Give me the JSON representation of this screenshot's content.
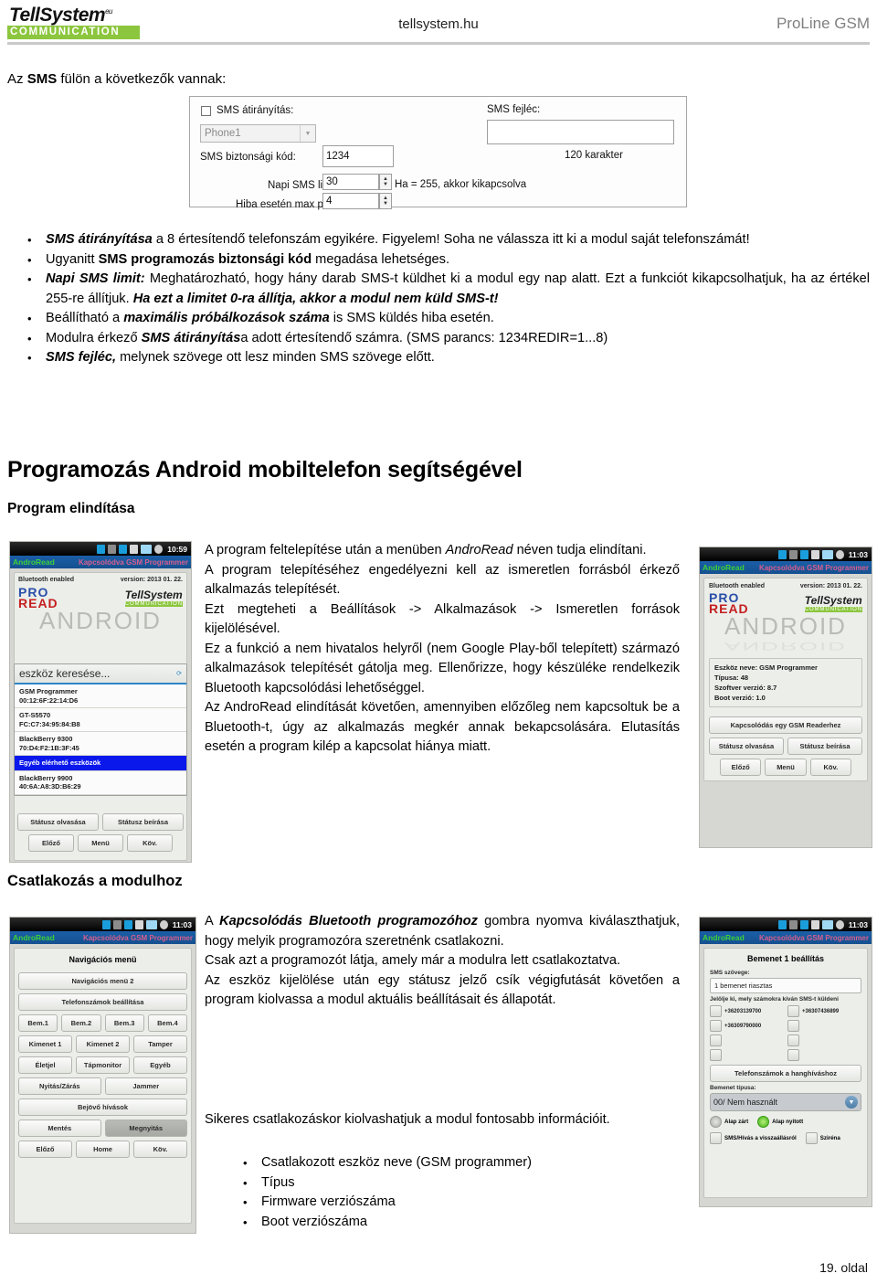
{
  "header": {
    "logo_word": "TellSystem",
    "logo_super": "eu",
    "logo_band": "COMMUNICATION",
    "site": "tellsystem.hu",
    "product": "ProLine GSM"
  },
  "intro": {
    "prefix": "Az ",
    "bold": "SMS",
    "suffix": " fülön a következők vannak:"
  },
  "sms_panel": {
    "redirect_checkbox_label": "SMS átirányítás:",
    "phone_select_value": "Phone1",
    "security_code_label": "SMS biztonsági kód:",
    "security_code_value": "1234",
    "daily_limit_label": "Napi SMS limit:",
    "daily_limit_value": "30",
    "daily_limit_hint": "Ha = 255, akkor kikapcsolva",
    "max_retry_label": "Hiba esetén max próba:",
    "max_retry_value": "4",
    "header_label": "SMS fejléc:",
    "header_value": "",
    "char_count": "120 karakter"
  },
  "sms_bullets": [
    {
      "parts": [
        {
          "t": "SMS átirányítása",
          "s": "bi"
        },
        {
          "t": " a 8 értesítendő telefonszám egyikére. Figyelem! Soha ne válassza itt ki a modul saját telefonszámát!",
          "s": ""
        }
      ]
    },
    {
      "parts": [
        {
          "t": "Ugyanitt ",
          "s": ""
        },
        {
          "t": "SMS programozás biztonsági kód",
          "s": "bb"
        },
        {
          "t": " megadása lehetséges.",
          "s": ""
        }
      ]
    },
    {
      "parts": [
        {
          "t": "Napi SMS limit:",
          "s": "bi"
        },
        {
          "t": " Meghatározható, hogy hány darab SMS-t küldhet ki a modul egy nap alatt. Ezt a funkciót kikapcsolhatjuk, ha az értékel 255-re állítjuk. ",
          "s": ""
        },
        {
          "t": "Ha ezt a limitet 0-ra állítja, akkor a modul nem küld SMS-t!",
          "s": "bi"
        }
      ]
    },
    {
      "parts": [
        {
          "t": "Beállítható a ",
          "s": ""
        },
        {
          "t": "maximális próbálkozások száma",
          "s": "bi"
        },
        {
          "t": " is SMS küldés hiba esetén.",
          "s": ""
        }
      ]
    },
    {
      "parts": [
        {
          "t": "Modulra érkező ",
          "s": ""
        },
        {
          "t": "SMS átirányítás",
          "s": "bi"
        },
        {
          "t": "a adott értesítendő számra. (SMS parancs: 1234REDIR=1...8)",
          "s": ""
        }
      ]
    },
    {
      "parts": [
        {
          "t": "SMS fejléc,",
          "s": "bi"
        },
        {
          "t": " melynek szövege ott lesz minden SMS szövege előtt.",
          "s": ""
        }
      ]
    }
  ],
  "section_title": "Programozás Android mobiltelefon segítségével",
  "subsection_start": "Program elindítása",
  "subsection_connect": "Csatlakozás a modulhoz",
  "top_text": [
    {
      "parts": [
        {
          "t": "A program feltelepítése után a menüben ",
          "s": ""
        },
        {
          "t": "AndroRead",
          "s": "i"
        },
        {
          "t": " néven tudja elindítani.",
          "s": ""
        }
      ]
    },
    {
      "parts": [
        {
          "t": "A program telepítéséhez engedélyezni kell az ismeretlen forrásból érkező alkalmazás telepítését.",
          "s": ""
        }
      ]
    },
    {
      "parts": [
        {
          "t": "Ezt megteheti a Beállítások -> Alkalmazások -> Ismeretlen források kijelölésével.",
          "s": ""
        }
      ]
    },
    {
      "parts": [
        {
          "t": "Ez a funkció a nem hivatalos helyről (nem Google Play-ből telepített) származó alkalmazások telepítését gátolja meg. Ellenőrizze, hogy készüléke rendelkezik Bluetooth kapcsolódási lehetőséggel.",
          "s": ""
        }
      ]
    },
    {
      "parts": [
        {
          "t": "Az AndroRead elindítását követően, amennyiben előzőleg nem kapcsoltuk be a Bluetooth-t, úgy az alkalmazás megkér annak bekapcsolására. Elutasítás esetén a program kilép a kapcsolat hiánya miatt.",
          "s": ""
        }
      ]
    }
  ],
  "bottom_text": [
    {
      "parts": [
        {
          "t": "A ",
          "s": ""
        },
        {
          "t": "Kapcsolódás Bluetooth programozóhoz",
          "s": "bi"
        },
        {
          "t": " gombra nyomva kiválaszthatjuk, hogy melyik programozóra szeretnénk csatlakozni.",
          "s": ""
        }
      ]
    },
    {
      "parts": [
        {
          "t": "Csak azt a programozót látja, amely már a modulra lett csatlakoztatva.",
          "s": ""
        }
      ]
    },
    {
      "parts": [
        {
          "t": "Az eszköz kijelölése után egy státusz jelző csík végigfutását követően a program kiolvassa a modul aktuális beállításait és állapotát.",
          "s": ""
        }
      ]
    }
  ],
  "bottom_text2": "Sikeres csatlakozáskor kiolvashatjuk a modul fontosabb információit.",
  "bottom_bullets": [
    "Csatlakozott eszköz neve (GSM programmer)",
    "Típus",
    "Firmware verziószáma",
    "Boot verziószáma"
  ],
  "phone_device_list": {
    "time": "10:59",
    "app_name": "AndroRead",
    "title_right": "Kapcsolódva GSM Programmer",
    "bt_status": "Bluetooth enabled",
    "version": "version: 2013 01. 22.",
    "logo_pro": "PRO",
    "logo_read": "READ",
    "ts_word": "TellSystem",
    "ts_band": "COMMUNICATION",
    "android_word": "ANDROID",
    "dialog_title": "eszköz keresése...",
    "devices": [
      {
        "name": "GSM Programmer",
        "mac": "00:12:6F:22:14:D6",
        "selected": false
      },
      {
        "name": "GT-S5570",
        "mac": "FC:C7:34:95:84:B8",
        "selected": false
      },
      {
        "name": "BlackBerry 9300",
        "mac": "70:D4:F2:1B:3F:45",
        "selected": false
      },
      {
        "name": "Egyéb elérhető eszközök",
        "mac": "",
        "selected": true
      },
      {
        "name": "BlackBerry 9900",
        "mac": "40:6A:A8:3D:B6:29",
        "selected": false
      }
    ],
    "btn_status_read": "Státusz olvasása",
    "btn_status_write": "Státusz beírása",
    "btn_prev": "Előző",
    "btn_menu": "Menü",
    "btn_next": "Köv."
  },
  "phone_connected": {
    "time": "11:03",
    "app_name": "AndroRead",
    "title_right": "Kapcsolódva GSM Programmer",
    "bt_status": "Bluetooth enabled",
    "version": "version: 2013 01. 22.",
    "logo_pro": "PRO",
    "logo_read": "READ",
    "ts_word": "TellSystem",
    "ts_band": "COMMUNICATION",
    "android_word": "ANDROID",
    "info_lines": [
      "Eszköz neve: GSM Programmer",
      "Típusa: 48",
      "Szoftver verzió: 8.7",
      "Boot verzió: 1.0"
    ],
    "btn_connect": "Kapcsolódás egy GSM Readerhez",
    "btn_status_read": "Státusz olvasása",
    "btn_status_write": "Státusz beírása",
    "btn_prev": "Előző",
    "btn_menu": "Menü",
    "btn_next": "Köv."
  },
  "phone_nav_menu": {
    "time": "11:03",
    "app_name": "AndroRead",
    "title_right": "Kapcsolódva GSM Programmer",
    "title": "Navigációs menü",
    "rows": [
      [
        "Navigációs menü 2"
      ],
      [
        "Telefonszámok beállítása"
      ],
      [
        "Bem.1",
        "Bem.2",
        "Bem.3",
        "Bem.4"
      ],
      [
        "Kimenet 1",
        "Kimenet 2",
        "Tamper"
      ],
      [
        "Életjel",
        "Tápmonitor",
        "Egyéb"
      ],
      [
        "Nyitás/Zárás",
        "Jammer"
      ],
      [
        "Bejövő hívások"
      ],
      [
        "Mentés",
        "Megnyitás"
      ],
      [
        "Előző",
        "Home",
        "Köv."
      ]
    ],
    "highlight": "Megnyitás"
  },
  "phone_input_settings": {
    "time": "11:03",
    "app_name": "AndroRead",
    "title_right": "Kapcsolódva GSM Programmer",
    "title": "Bemenet 1 beállítás",
    "sms_text_label": "SMS szövege:",
    "sms_text_value": "1 bemenet riasztas",
    "select_numbers_label": "Jelölje ki, mely számokra kíván SMS-t küldeni",
    "numbers": [
      "+36203139700",
      "+36307436899",
      "+36309790000",
      "",
      "",
      "",
      "",
      ""
    ],
    "btn_voice_numbers": "Telefonszámok a hanghíváshoz",
    "input_type_label": "Bemenet típusa:",
    "input_type_value": "00/ Nem használt",
    "radio_closed": "Alap zárt",
    "radio_open": "Alap nyitott",
    "chk_sms_restore": "SMS/Hívás a visszaállásról",
    "chk_siren": "Sziréna"
  },
  "footer": "19. oldal",
  "colors": {
    "brand_green": "#8CC63E",
    "title_blue": "#15508f",
    "selection_blue": "#0a18ec",
    "product_gray": "#808080"
  }
}
